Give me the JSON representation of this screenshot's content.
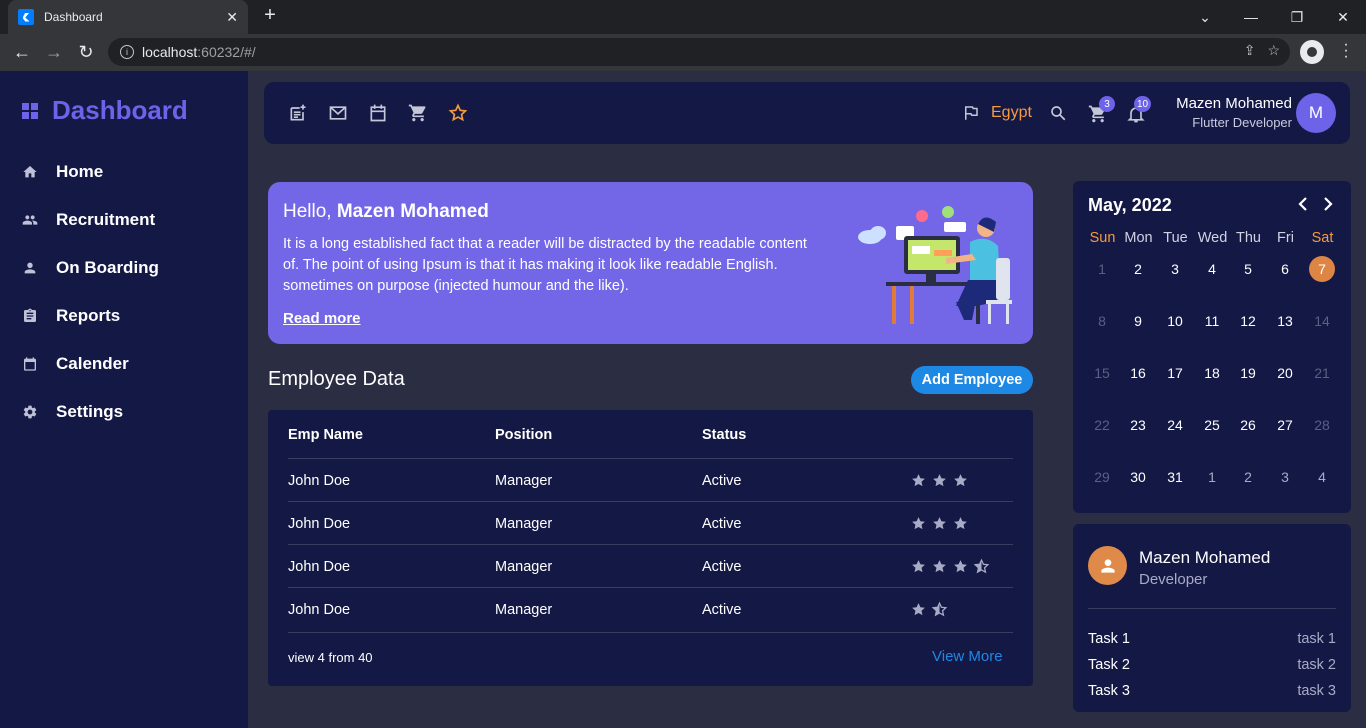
{
  "browser": {
    "tab_title": "Dashboard",
    "url_host": "localhost",
    "url_rest": ":60232/#/"
  },
  "sidebar": {
    "logo": "Dashboard",
    "items": [
      {
        "label": "Home",
        "icon": "home-icon"
      },
      {
        "label": "Recruitment",
        "icon": "people-icon"
      },
      {
        "label": "On Boarding",
        "icon": "person-icon"
      },
      {
        "label": "Reports",
        "icon": "clipboard-icon"
      },
      {
        "label": "Calender",
        "icon": "calendar-icon"
      },
      {
        "label": "Settings",
        "icon": "gear-icon"
      }
    ]
  },
  "topbar": {
    "country": "Egypt",
    "cart_count": "3",
    "notifications_count": "10",
    "user_name": "Mazen Mohamed",
    "user_role": "Flutter Developer",
    "avatar_letter": "M"
  },
  "hero": {
    "greeting": "Hello, ",
    "name": "Mazen Mohamed",
    "text": "It is a long established fact that a reader will be distracted by the readable content of. The point of using Ipsum is that it has making it look like readable English. sometimes on purpose (injected humour and the like).",
    "link": "Read more"
  },
  "employees": {
    "title": "Employee Data",
    "add_button": "Add Employee",
    "headers": [
      "Emp Name",
      "Position",
      "Status"
    ],
    "rows": [
      {
        "name": "John Doe",
        "position": "Manager",
        "status": "Active",
        "rating": 3
      },
      {
        "name": "John Doe",
        "position": "Manager",
        "status": "Active",
        "rating": 3
      },
      {
        "name": "John Doe",
        "position": "Manager",
        "status": "Active",
        "rating": 3.5
      },
      {
        "name": "John Doe",
        "position": "Manager",
        "status": "Active",
        "rating": 1.5
      }
    ],
    "footer_count": "view 4 from 40",
    "view_more": "View More"
  },
  "calendar": {
    "month": "May, 2022",
    "weekdays": [
      "Sun",
      "Mon",
      "Tue",
      "Wed",
      "Thu",
      "Fri",
      "Sat"
    ],
    "weeks": [
      [
        "1",
        "2",
        "3",
        "4",
        "5",
        "6",
        "7"
      ],
      [
        "8",
        "9",
        "10",
        "11",
        "12",
        "13",
        "14"
      ],
      [
        "15",
        "16",
        "17",
        "18",
        "19",
        "20",
        "21"
      ],
      [
        "22",
        "23",
        "24",
        "25",
        "26",
        "27",
        "28"
      ],
      [
        "29",
        "30",
        "31",
        "1",
        "2",
        "3",
        "4"
      ]
    ],
    "selected": "7",
    "weekend_color": "#f59a3e"
  },
  "profile_card": {
    "name": "Mazen Mohamed",
    "role": "Developer",
    "tasks": [
      {
        "label": "Task 1",
        "value": "task 1"
      },
      {
        "label": "Task 2",
        "value": "task 2"
      },
      {
        "label": "Task 3",
        "value": "task 3"
      }
    ]
  },
  "colors": {
    "accent": "#6c63e8",
    "hero_bg": "#7367e8",
    "button_blue": "#1e88e5",
    "country": "#f59a3e"
  }
}
